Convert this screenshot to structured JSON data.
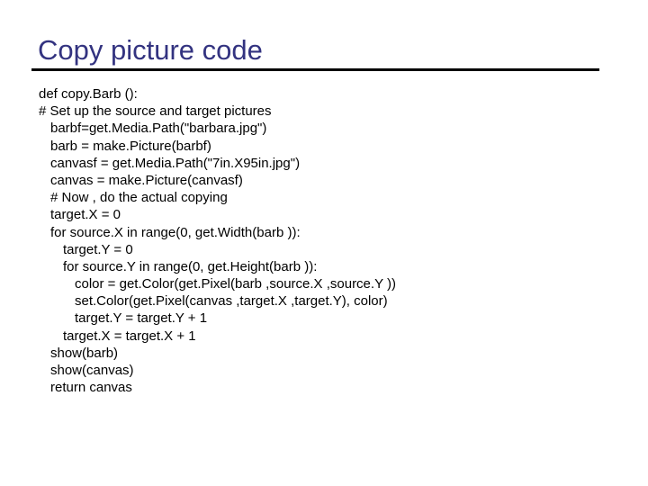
{
  "slide": {
    "title": "Copy picture code",
    "title_color": "#333380",
    "code_lines": [
      {
        "indent": 0,
        "text": "def copy.Barb ():"
      },
      {
        "indent": 0,
        "text": "# Set up the source and target pictures"
      },
      {
        "indent": 1,
        "text": "barbf=get.Media.Path(\"barbara.jpg\")"
      },
      {
        "indent": 1,
        "text": "barb = make.Picture(barbf)"
      },
      {
        "indent": 1,
        "text": "canvasf = get.Media.Path(\"7in.X95in.jpg\")"
      },
      {
        "indent": 1,
        "text": "canvas = make.Picture(canvasf)"
      },
      {
        "indent": 1,
        "text": "# Now , do the actual copying"
      },
      {
        "indent": 1,
        "text": "target.X = 0"
      },
      {
        "indent": 1,
        "text": "for source.X in range(0, get.Width(barb )):"
      },
      {
        "indent": 2,
        "text": "target.Y = 0"
      },
      {
        "indent": 2,
        "text": "for source.Y in range(0, get.Height(barb )):"
      },
      {
        "indent": 3,
        "text": "color = get.Color(get.Pixel(barb ,source.X ,source.Y ))"
      },
      {
        "indent": 3,
        "text": "set.Color(get.Pixel(canvas ,target.X ,target.Y), color)"
      },
      {
        "indent": 3,
        "text": "target.Y = target.Y + 1"
      },
      {
        "indent": 2,
        "text": "target.X = target.X + 1"
      },
      {
        "indent": 1,
        "text": "show(barb)"
      },
      {
        "indent": 1,
        "text": "show(canvas)"
      },
      {
        "indent": 1,
        "text": "return canvas"
      }
    ]
  }
}
